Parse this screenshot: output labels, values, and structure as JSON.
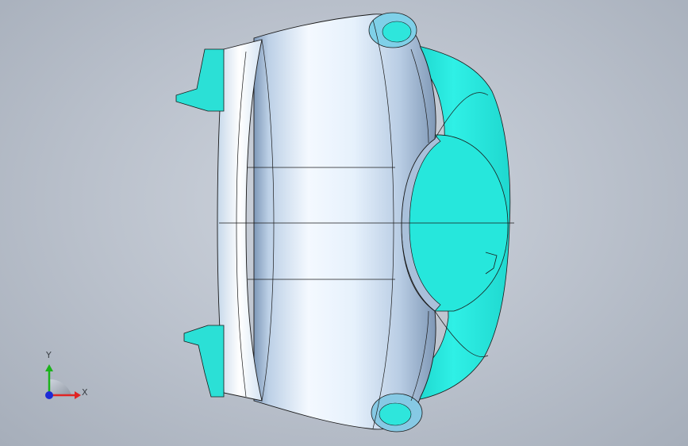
{
  "window": {
    "background_top": "#cfd5de",
    "background_bottom": "#a6aeba"
  },
  "model": {
    "body_color": "#d8ecff",
    "cut_face_color": "#26e3d8",
    "edge_color": "#1a1a1a"
  },
  "triad": {
    "x_label": "X",
    "y_label": "Y",
    "x_color": "#e02424",
    "y_color": "#1bb31b",
    "z_color": "#1c2bd6"
  }
}
